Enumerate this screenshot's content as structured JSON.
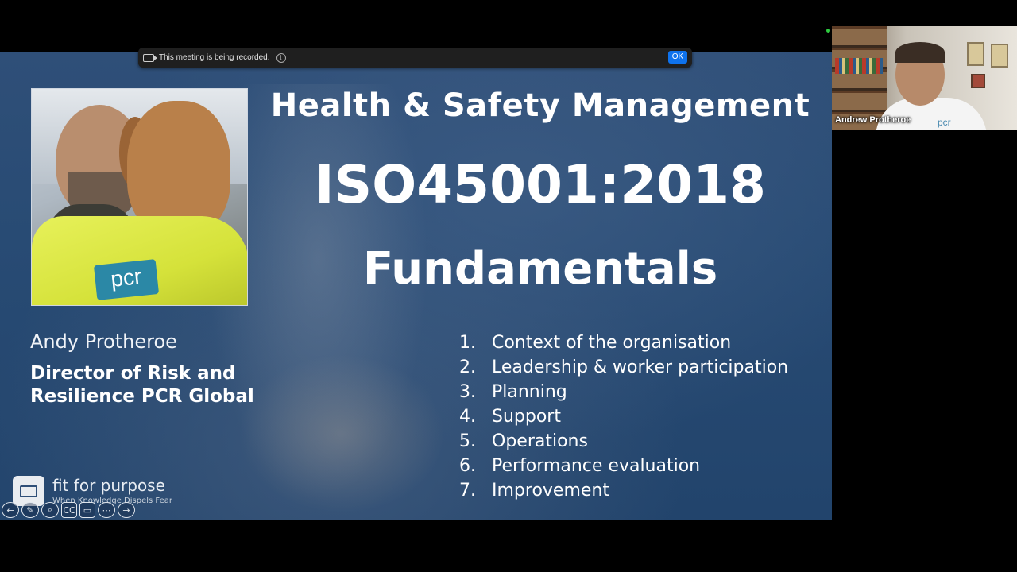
{
  "recording_banner": {
    "text": "This meeting is being recorded.",
    "ok_label": "OK"
  },
  "slide": {
    "title": "Health & Safety Management",
    "code": "ISO45001:2018",
    "subtitle": "Fundamentals",
    "presenter_name": "Andy Protheroe",
    "presenter_role": "Director of Risk and Resilience PCR Global",
    "photo_logo": "pcr",
    "topics": [
      {
        "num": "1.",
        "label": "Context of the organisation"
      },
      {
        "num": "2.",
        "label": "Leadership & worker participation"
      },
      {
        "num": "3.",
        "label": "Planning"
      },
      {
        "num": "4.",
        "label": "Support"
      },
      {
        "num": "5.",
        "label": "Operations"
      },
      {
        "num": "6.",
        "label": "Performance evaluation"
      },
      {
        "num": "7.",
        "label": "Improvement"
      }
    ],
    "brand": {
      "name": "fit for purpose",
      "tagline": "When Knowledge Dispels Fear"
    },
    "controls": {
      "prev": "←",
      "pen": "✎",
      "zoom": "⌕",
      "captions": "CC",
      "screen": "▭",
      "more": "⋯",
      "next": "→"
    }
  },
  "participant": {
    "name": "Andrew Protheroe",
    "shirt_logo": "pcr"
  },
  "colors": {
    "slide_bg": "#284b74",
    "ok_button": "#0e72ed",
    "banner_bg": "#1f1f1f"
  }
}
